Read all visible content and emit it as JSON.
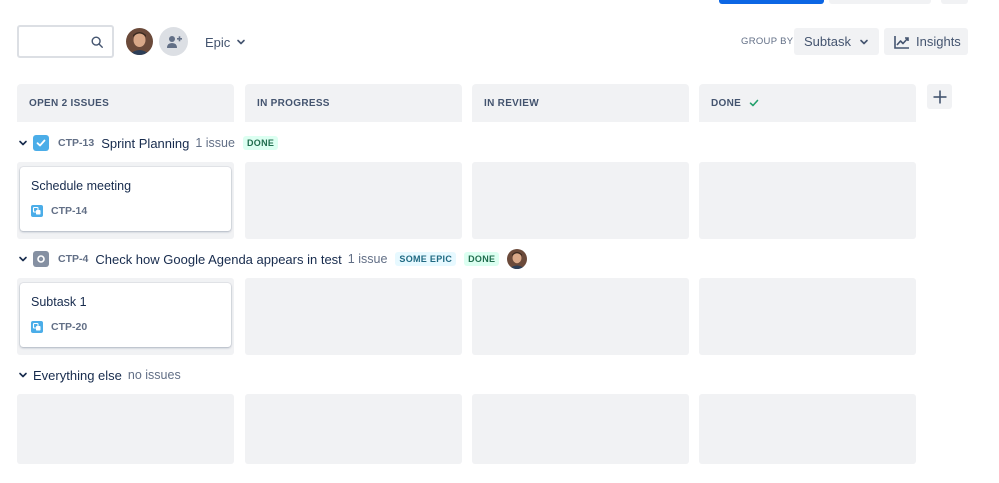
{
  "toolbar": {
    "search_placeholder": "",
    "epic_filter_label": "Epic",
    "group_by_label": "GROUP BY",
    "group_by_value": "Subtask",
    "insights_label": "Insights"
  },
  "columns": [
    {
      "label": "OPEN 2 ISSUES",
      "check": false
    },
    {
      "label": "IN PROGRESS",
      "check": false
    },
    {
      "label": "IN REVIEW",
      "check": false
    },
    {
      "label": "DONE",
      "check": true
    }
  ],
  "swimlanes": [
    {
      "key": "CTP-13",
      "title": "Sprint Planning",
      "count": "1 issue",
      "lozenges": [
        "DONE"
      ],
      "card": {
        "title": "Schedule meeting",
        "key": "CTP-14"
      }
    },
    {
      "key": "CTP-4",
      "title": "Check how Google Agenda appears in test",
      "count": "1 issue",
      "lozenges": [
        "SOME EPIC",
        "DONE"
      ],
      "card": {
        "title": "Subtask 1",
        "key": "CTP-20"
      }
    },
    {
      "title": "Everything else",
      "count": "no issues"
    }
  ],
  "colors": {
    "primary": "#0c66e4",
    "column_bg": "#f1f2f4",
    "task_icon": "#4bade8",
    "done_lozenge_bg": "#dcfff1",
    "done_lozenge_text": "#216e4e",
    "epic_lozenge_bg": "#e7f9ff",
    "epic_lozenge_text": "#206a83",
    "done_check": "#22a06b"
  },
  "icons": [
    "search-icon",
    "avatar",
    "add-people-icon",
    "chevron-down-icon",
    "insights-chart-icon",
    "plus-icon",
    "check-icon",
    "task-checkbox-icon",
    "subtask-icon"
  ]
}
